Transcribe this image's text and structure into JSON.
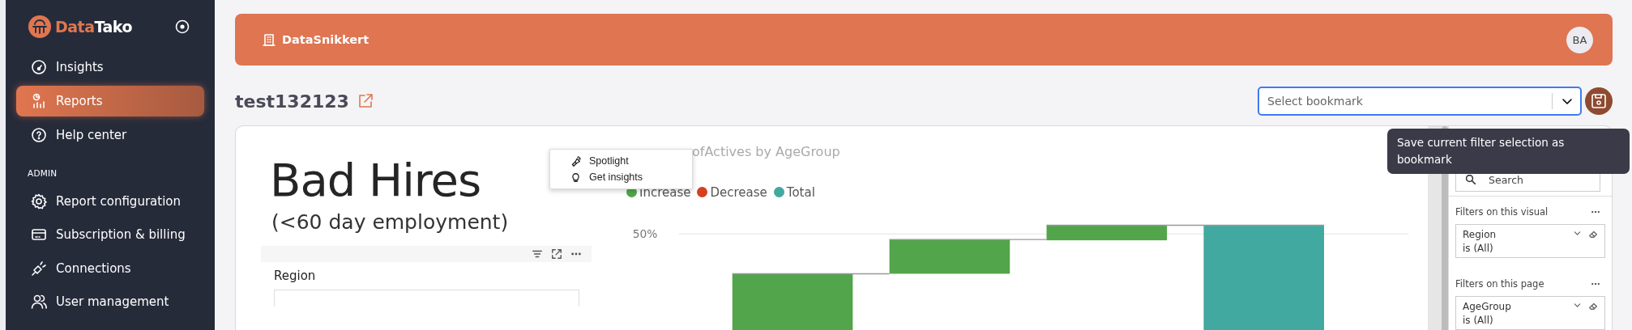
{
  "sidebar": {
    "brand_part1": "Data",
    "brand_part2": "Tako",
    "items": [
      {
        "label": "Insights",
        "selected": false
      },
      {
        "label": "Reports",
        "selected": true
      },
      {
        "label": "Help center",
        "selected": false
      }
    ],
    "section": "ADMIN",
    "admin_items": [
      {
        "label": "Report configuration"
      },
      {
        "label": "Subscription & billing"
      },
      {
        "label": "Connections"
      },
      {
        "label": "User management"
      }
    ]
  },
  "banner": {
    "organization": "DataSnikkert",
    "avatar": "BA"
  },
  "report": {
    "title": "test132123",
    "bookmark_select": {
      "placeholder": "Select bookmark"
    }
  },
  "tooltip": "Save current filter selection as bookmark",
  "canvas": {
    "heading": "Bad Hires",
    "subheading": "(<60 day employment)",
    "slicer": {
      "title": "Region"
    },
    "context_menu": [
      "Spotlight",
      "Get insights"
    ],
    "chart": {
      "title": "ofActives by AgeGroup",
      "legend": [
        {
          "label": "Increase",
          "color": "#52a54a"
        },
        {
          "label": "Decrease",
          "color": "#d63f22"
        },
        {
          "label": "Total",
          "color": "#42a9a0"
        }
      ],
      "tick": "50%"
    }
  },
  "filters": {
    "search": {
      "placeholder": "Search"
    },
    "sections": [
      {
        "title": "Filters on this visual",
        "cards": [
          {
            "field": "Region",
            "condition": "is (All)"
          }
        ]
      },
      {
        "title": "Filters on this page",
        "cards": [
          {
            "field": "AgeGroup",
            "condition": "is (All)"
          }
        ]
      }
    ]
  }
}
